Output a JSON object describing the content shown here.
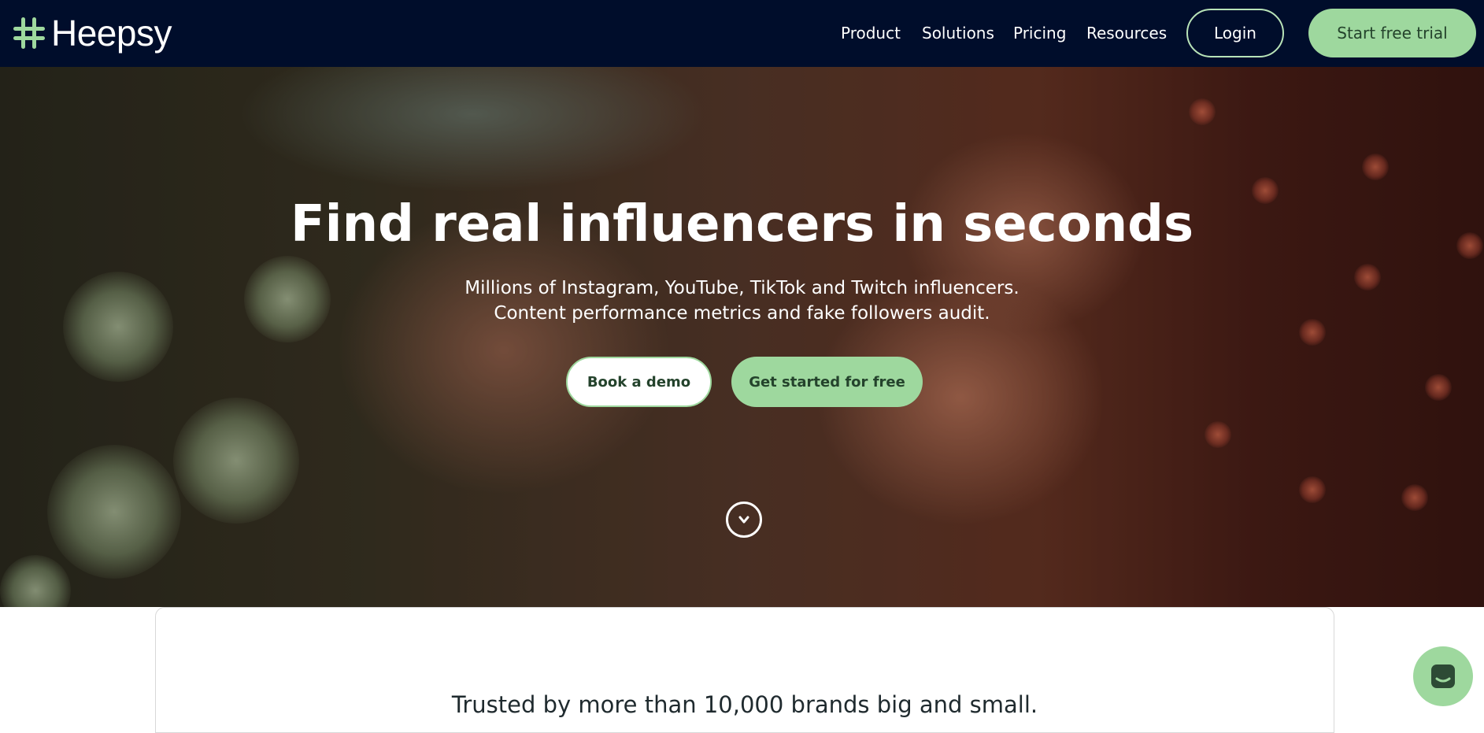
{
  "brand": {
    "name": "Heepsy",
    "accent_color": "#9ed89e",
    "nav_background": "#000d2b"
  },
  "nav": {
    "items": [
      {
        "label": "Product"
      },
      {
        "label": "Solutions"
      },
      {
        "label": "Pricing"
      },
      {
        "label": "Resources"
      }
    ],
    "login_label": "Login",
    "trial_label": "Start free trial"
  },
  "hero": {
    "title": "Find real influencers in seconds",
    "subtitle_line1": "Millions of Instagram, YouTube, TikTok and Twitch influencers.",
    "subtitle_line2": "Content performance metrics and fake followers audit.",
    "demo_label": "Book a demo",
    "get_started_label": "Get started for free",
    "scroll_icon": "chevron-down-icon"
  },
  "trust": {
    "text": "Trusted by more than 10,000 brands big and small."
  },
  "chat": {
    "icon": "chat-icon"
  }
}
